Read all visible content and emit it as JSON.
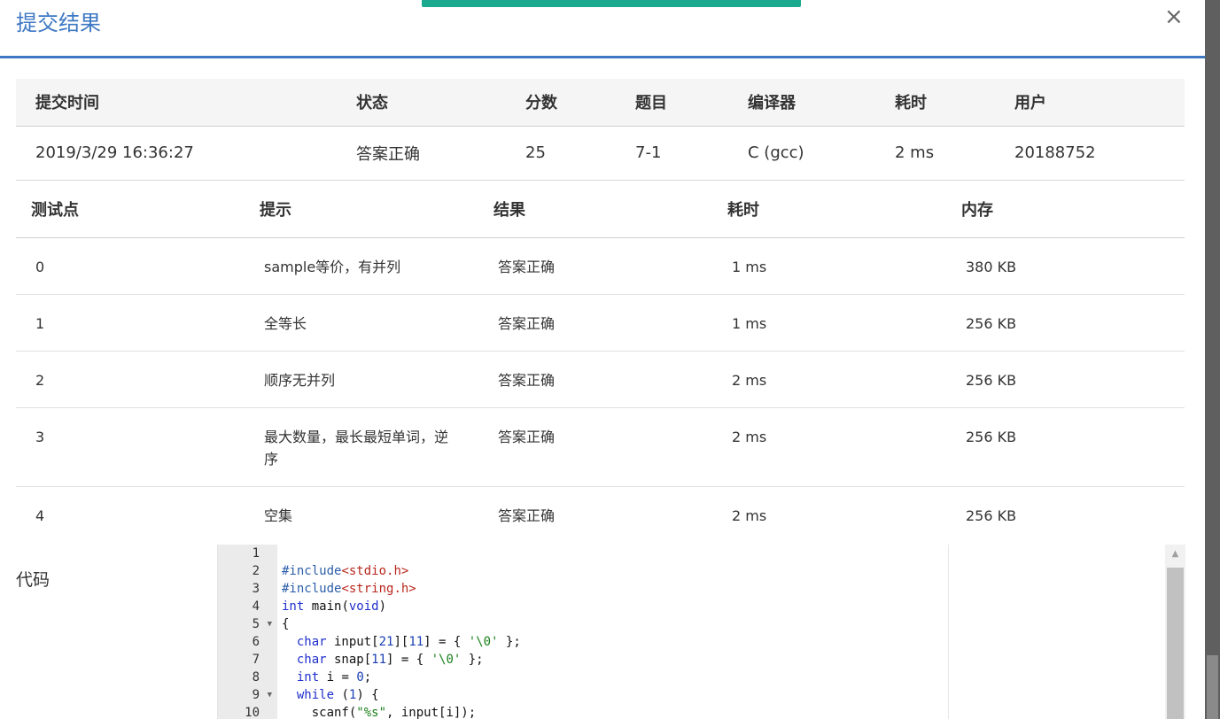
{
  "dialog": {
    "title": "提交结果",
    "close_icon": "×"
  },
  "summary": {
    "headers": [
      "提交时间",
      "状态",
      "分数",
      "题目",
      "编译器",
      "耗时",
      "用户"
    ],
    "row": {
      "time": "2019/3/29 16:36:27",
      "status": "答案正确",
      "score": "25",
      "problem": "7-1",
      "compiler": "C (gcc)",
      "elapsed": "2 ms",
      "user": "20188752"
    }
  },
  "cases": {
    "headers": [
      "测试点",
      "提示",
      "结果",
      "耗时",
      "内存"
    ],
    "rows": [
      {
        "id": "0",
        "hint": "sample等价，有并列",
        "result": "答案正确",
        "time": "1 ms",
        "memory": "380 KB"
      },
      {
        "id": "1",
        "hint": "全等长",
        "result": "答案正确",
        "time": "1 ms",
        "memory": "256 KB"
      },
      {
        "id": "2",
        "hint": "顺序无并列",
        "result": "答案正确",
        "time": "2 ms",
        "memory": "256 KB"
      },
      {
        "id": "3",
        "hint": "最大数量，最长最短单词，逆序",
        "result": "答案正确",
        "time": "2 ms",
        "memory": "256 KB"
      },
      {
        "id": "4",
        "hint": "空集",
        "result": "答案正确",
        "time": "2 ms",
        "memory": "256 KB"
      }
    ]
  },
  "code": {
    "label": "代码",
    "line_numbers": [
      "1",
      "2",
      "3",
      "4",
      "5",
      "6",
      "7",
      "8",
      "9",
      "10"
    ],
    "lines": [
      "",
      "#include<stdio.h>",
      "#include<string.h>",
      "int main(void)",
      "{",
      "  char input[21][11] = { '\\0' };",
      "  char snap[11] = { '\\0' };",
      "  int i = 0;",
      "  while (1) {",
      "    scanf(\"%s\", input[i]);"
    ]
  },
  "colors": {
    "accent": "#3e78c4",
    "ok": "#e0463a",
    "link": "#2a5ea8",
    "toast": "#1aa98f"
  }
}
